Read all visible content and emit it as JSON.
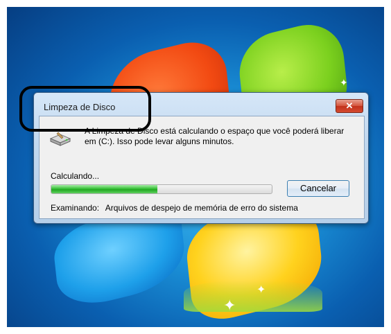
{
  "dialog": {
    "title": "Limpeza de Disco",
    "close_label": "✕",
    "description": "A Limpeza de Disco está calculando o espaço que você poderá liberar em  (C:). Isso pode levar alguns minutos.",
    "status_label": "Calculando...",
    "progress": 0.48,
    "cancel_label": "Cancelar",
    "examining_label": "Examinando:",
    "examining_value": "Arquivos de despejo de memória de erro do sistema"
  },
  "colors": {
    "progress_green": "#22a822",
    "close_red": "#c2321b",
    "title_bar": "#c1d8ef"
  },
  "icons": [
    "drive-cleanup-icon",
    "close-icon"
  ]
}
